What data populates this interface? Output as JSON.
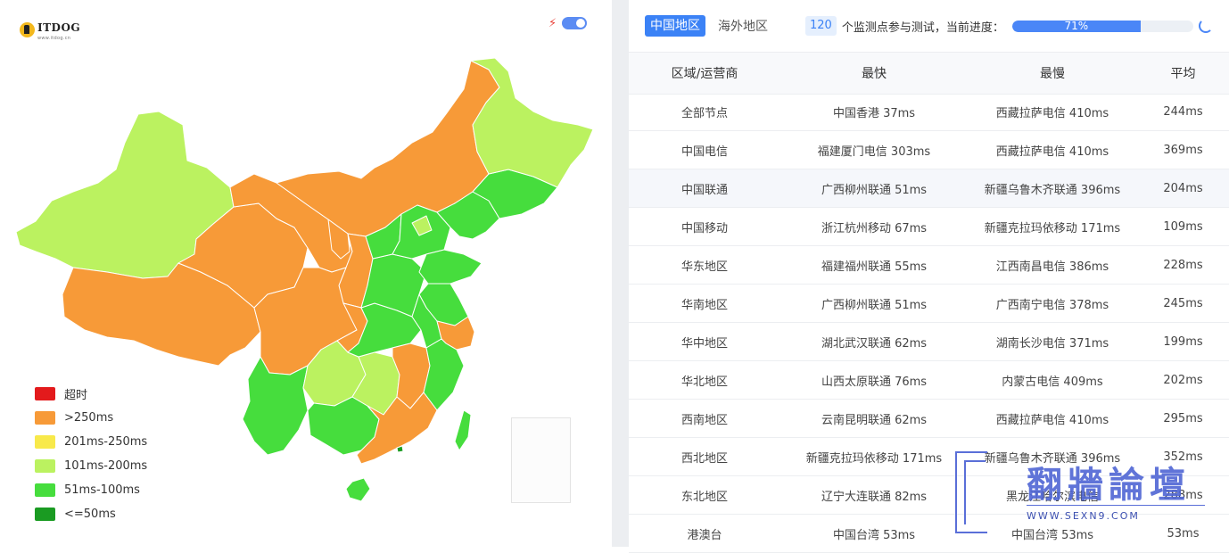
{
  "brand": {
    "logo_text": "ITDOG",
    "logo_sub": "www.itdog.cn"
  },
  "map": {
    "colors": {
      "timeout": "#e31a1c",
      "over250": "#f79a38",
      "r201_250": "#f8e94a",
      "r101_200": "#bbf260",
      "r51_100": "#46dd3d",
      "under50": "#1a9b22"
    },
    "legend": [
      {
        "label": "超时",
        "color": "#e31a1c"
      },
      {
        "label": ">250ms",
        "color": "#f79a38"
      },
      {
        "label": "201ms-250ms",
        "color": "#f8e94a"
      },
      {
        "label": "101ms-200ms",
        "color": "#bbf260"
      },
      {
        "label": "51ms-100ms",
        "color": "#46dd3d"
      },
      {
        "label": "<=50ms",
        "color": "#1a9b22"
      }
    ]
  },
  "tabs": {
    "china": "中国地区",
    "overseas": "海外地区"
  },
  "status": {
    "probe_count": "120",
    "probe_text": "个监测点参与测试，当前进度：",
    "progress": 0.71,
    "progress_label": "71%"
  },
  "table": {
    "headers": [
      "区域/运营商",
      "最快",
      "最慢",
      "平均"
    ],
    "rows": [
      {
        "region": "全部节点",
        "fastest": "中国香港 37ms",
        "slowest": "西藏拉萨电信 410ms",
        "avg": "244ms"
      },
      {
        "region": "中国电信",
        "fastest": "福建厦门电信 303ms",
        "slowest": "西藏拉萨电信 410ms",
        "avg": "369ms"
      },
      {
        "region": "中国联通",
        "fastest": "广西柳州联通 51ms",
        "slowest": "新疆乌鲁木齐联通 396ms",
        "avg": "204ms"
      },
      {
        "region": "中国移动",
        "fastest": "浙江杭州移动 67ms",
        "slowest": "新疆克拉玛依移动 171ms",
        "avg": "109ms"
      },
      {
        "region": "华东地区",
        "fastest": "福建福州联通 55ms",
        "slowest": "江西南昌电信 386ms",
        "avg": "228ms"
      },
      {
        "region": "华南地区",
        "fastest": "广西柳州联通 51ms",
        "slowest": "广西南宁电信 378ms",
        "avg": "245ms"
      },
      {
        "region": "华中地区",
        "fastest": "湖北武汉联通 62ms",
        "slowest": "湖南长沙电信 371ms",
        "avg": "199ms"
      },
      {
        "region": "华北地区",
        "fastest": "山西太原联通 76ms",
        "slowest": "内蒙古电信 409ms",
        "avg": "202ms"
      },
      {
        "region": "西南地区",
        "fastest": "云南昆明联通 62ms",
        "slowest": "西藏拉萨电信 410ms",
        "avg": "295ms"
      },
      {
        "region": "西北地区",
        "fastest": "新疆克拉玛依移动 171ms",
        "slowest": "新疆乌鲁木齐联通 396ms",
        "avg": "352ms"
      },
      {
        "region": "东北地区",
        "fastest": "辽宁大连联通 82ms",
        "slowest": "黑龙江哈尔滨电信",
        "avg": "288ms"
      },
      {
        "region": "港澳台",
        "fastest": "中国台湾 53ms",
        "slowest": "中国台湾 53ms",
        "avg": "53ms"
      }
    ]
  },
  "watermark": {
    "title": "翻牆論壇",
    "url": "WWW.SEXN9.COM"
  }
}
